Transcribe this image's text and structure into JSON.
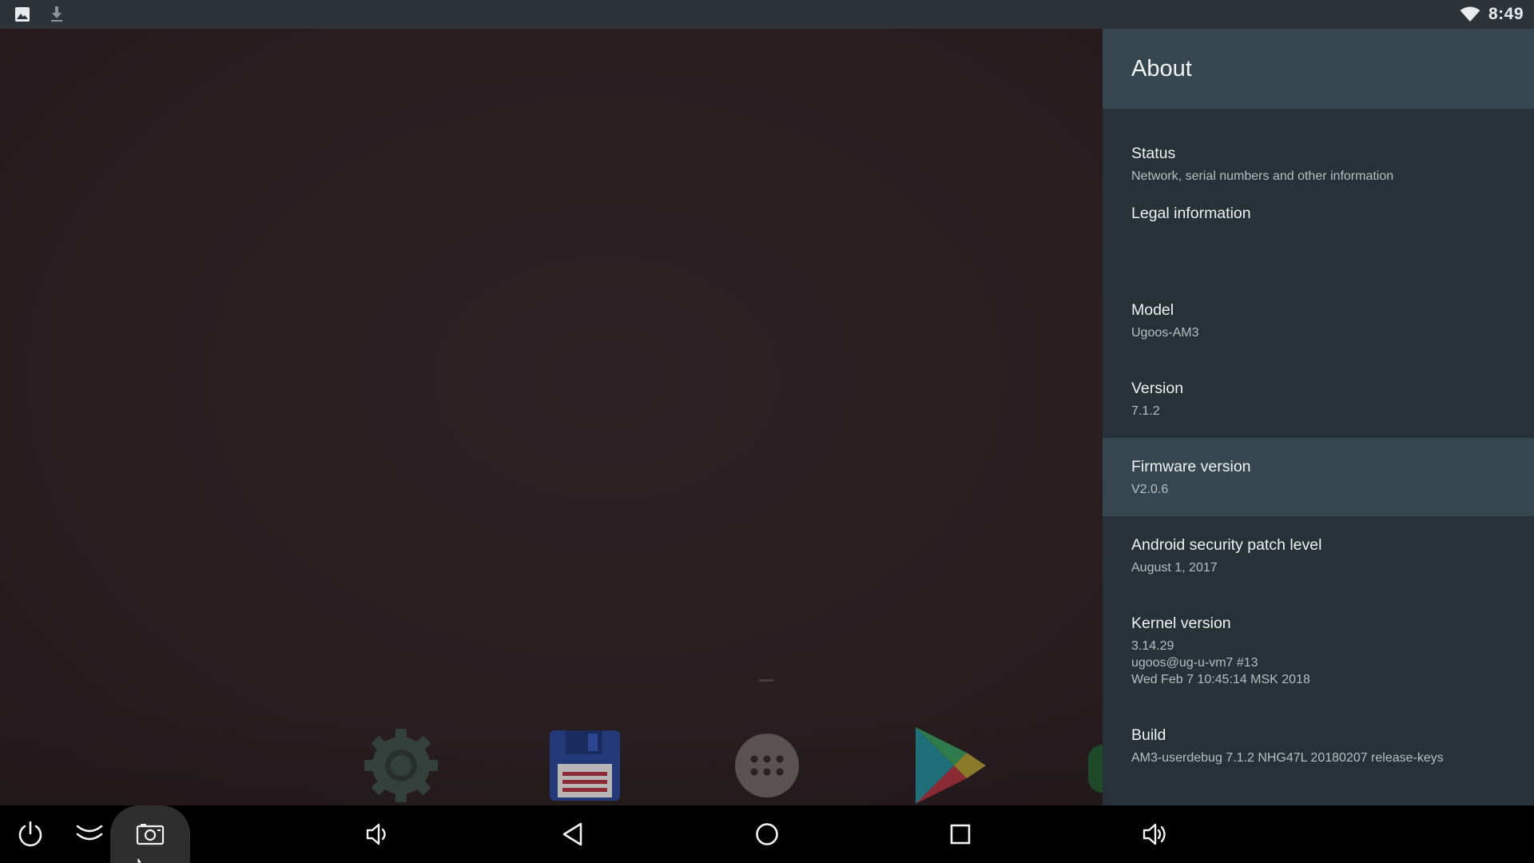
{
  "status_bar": {
    "left_icons": [
      "image-icon",
      "download-icon"
    ],
    "wifi_icon": "wifi-icon",
    "time": "8:49"
  },
  "launcher": {
    "dock_apps": [
      {
        "name": "settings-app",
        "icon": "gear-icon"
      },
      {
        "name": "file-manager-app",
        "icon": "floppy-disk-icon"
      },
      {
        "name": "all-apps",
        "icon": "app-drawer-icon"
      },
      {
        "name": "play-store-app",
        "icon": "play-store-icon"
      }
    ]
  },
  "panel": {
    "title": "About",
    "items": [
      {
        "title": "Status",
        "summary": "Network, serial numbers and other information"
      },
      {
        "title": "Legal information"
      },
      {
        "title": "Model",
        "summary": "Ugoos-AM3"
      },
      {
        "title": "Version",
        "summary": "7.1.2"
      },
      {
        "title": "Firmware version",
        "summary": "V2.0.6"
      },
      {
        "title": "Android security patch level",
        "summary": "August 1, 2017"
      },
      {
        "title": "Kernel version",
        "summary_lines": [
          "3.14.29",
          "ugoos@ug-u-vm7 #13",
          "Wed Feb 7 10:45:14 MSK 2018"
        ]
      },
      {
        "title": "Build",
        "summary": "AM3-userdebug 7.1.2 NHG47L 20180207 release-keys"
      }
    ],
    "focused_index": 4
  },
  "nav_bar": {
    "buttons": [
      "power-icon",
      "collapse-icon",
      "screenshot-icon",
      "volume-down-icon",
      "back-icon",
      "home-icon",
      "recents-icon",
      "volume-up-icon"
    ]
  },
  "colors": {
    "status_bar": "#2c3439",
    "panel": "#263238",
    "panel_header": "#37474f",
    "focused_row": "#37474f"
  }
}
